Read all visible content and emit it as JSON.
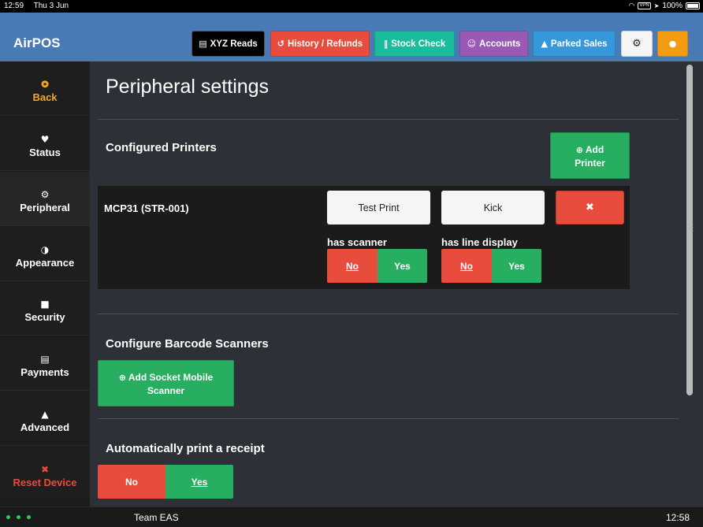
{
  "status_bar": {
    "time": "12:59",
    "date": "Thu 3 Jun",
    "vpn": "VPN",
    "battery": "100%"
  },
  "app": {
    "title": "AirPOS"
  },
  "toolbar": {
    "xyz_reads": "XYZ Reads",
    "history_refunds": "History / Refunds",
    "stock_check": "Stock Check",
    "accounts": "Accounts",
    "parked_sales": "Parked Sales"
  },
  "colors": {
    "topbar": "#4a7ab6",
    "green": "#27ae60",
    "red": "#e74c3c",
    "teal": "#1abc9c",
    "purple": "#9b59b6",
    "blue": "#3498db",
    "orange": "#f39c12"
  },
  "sidebar": {
    "items": [
      {
        "label": "Back",
        "icon": "back-circle-icon"
      },
      {
        "label": "Status",
        "icon": "heartbeat-icon"
      },
      {
        "label": "Peripheral",
        "icon": "gear-icon"
      },
      {
        "label": "Appearance",
        "icon": "contrast-icon"
      },
      {
        "label": "Security",
        "icon": "lock-icon"
      },
      {
        "label": "Payments",
        "icon": "cart-icon"
      },
      {
        "label": "Advanced",
        "icon": "warning-icon"
      },
      {
        "label": "Reset Device",
        "icon": "x-icon"
      }
    ]
  },
  "main": {
    "title": "Peripheral settings",
    "printers": {
      "heading": "Configured Printers",
      "add_label_1": "Add",
      "add_label_2": "Printer",
      "rows": [
        {
          "name": "MCP31 (STR-001)",
          "test_print": "Test Print",
          "kick": "Kick",
          "has_scanner_label": "has scanner",
          "has_display_label": "has line display",
          "no": "No",
          "yes": "Yes"
        }
      ]
    },
    "scanners": {
      "heading": "Configure Barcode Scanners",
      "add_label_1": "Add Socket Mobile",
      "add_label_2": "Scanner"
    },
    "receipt": {
      "heading": "Automatically print a receipt",
      "no": "No",
      "yes": "Yes"
    }
  },
  "footer": {
    "team": "Team EAS",
    "time": "12:58"
  }
}
